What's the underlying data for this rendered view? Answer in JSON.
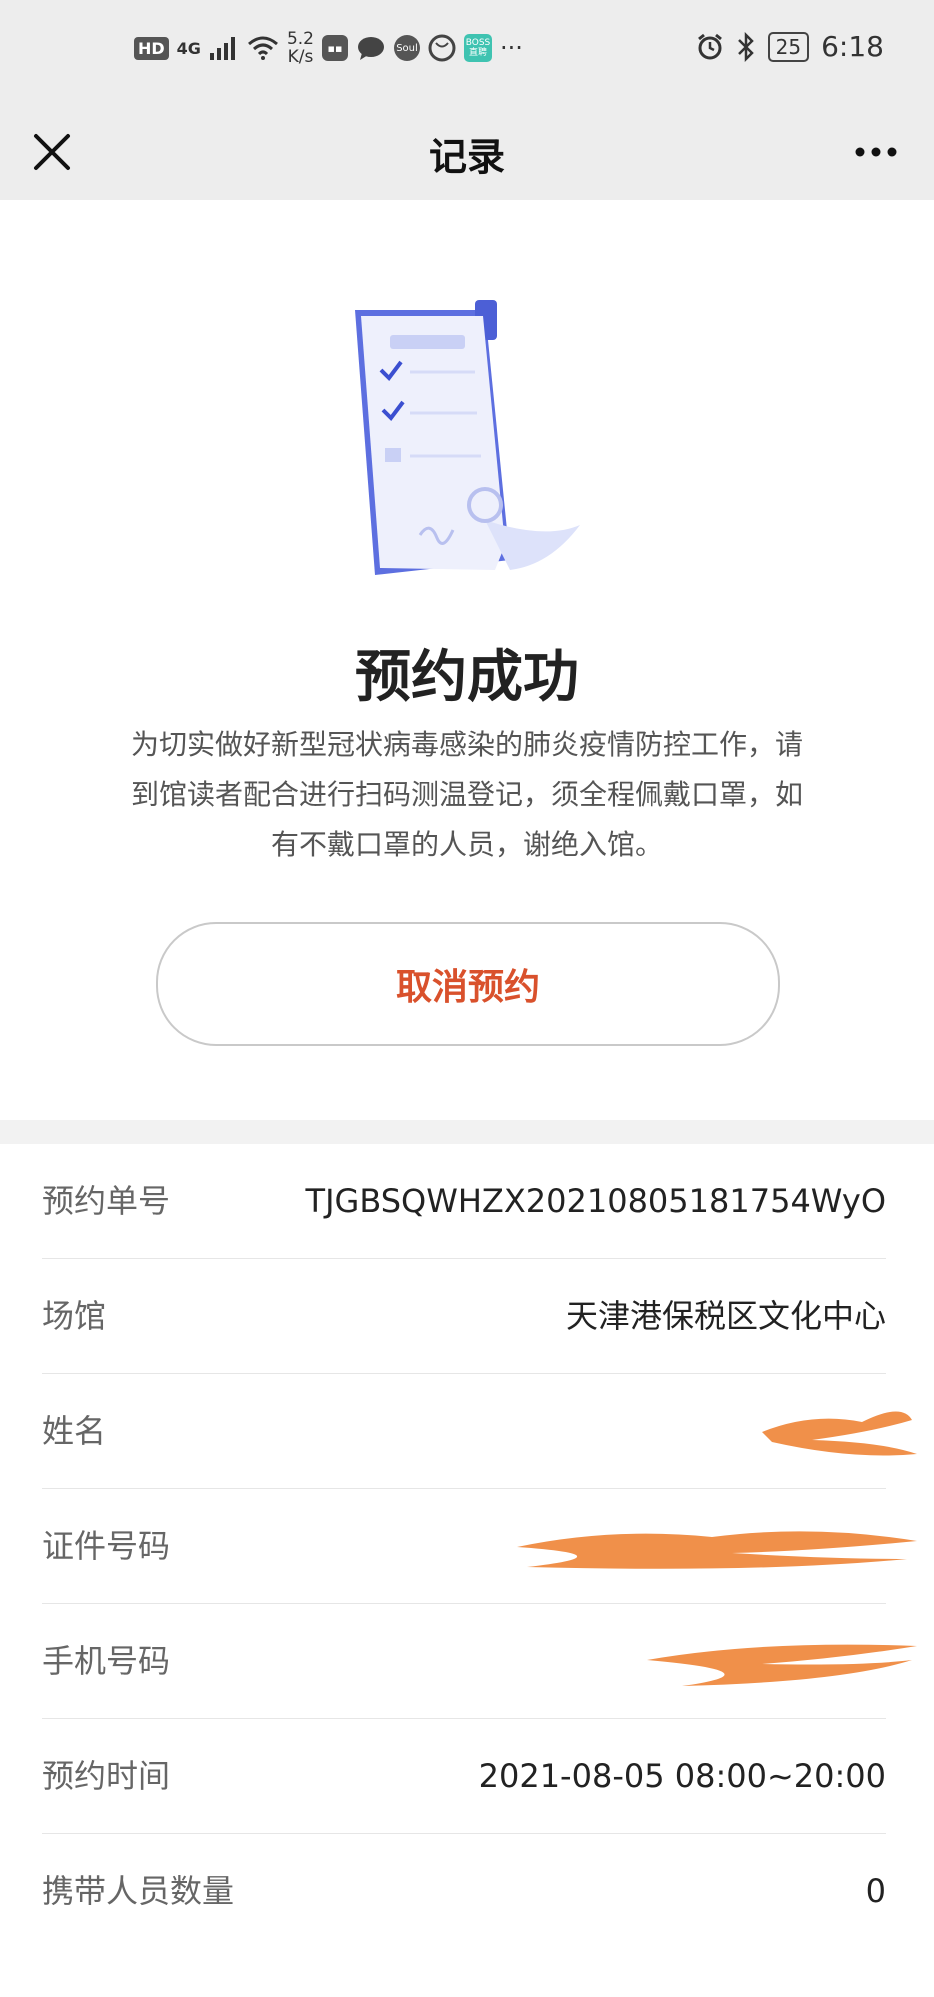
{
  "status_bar": {
    "hd": "HD",
    "network": "4G",
    "speed_value": "5.2",
    "speed_unit": "K/s",
    "soul": "Soul",
    "boss": "BOSS直聘",
    "more": "···",
    "battery": "25",
    "time": "6:18"
  },
  "nav": {
    "title": "记录"
  },
  "hero": {
    "title": "预约成功",
    "description": "为切实做好新型冠状病毒感染的肺炎疫情防控工作，请到馆读者配合进行扫码测温登记，须全程佩戴口罩，如有不戴口罩的人员，谢绝入馆。",
    "cancel_label": "取消预约"
  },
  "info": {
    "rows": [
      {
        "label": "预约单号",
        "value": "TJGBSQWHZX20210805181754WyO"
      },
      {
        "label": "场馆",
        "value": "天津港保税区文化中心"
      },
      {
        "label": "姓名",
        "value": "",
        "redacted": true
      },
      {
        "label": "证件号码",
        "value": "",
        "redacted": true
      },
      {
        "label": "手机号码",
        "value": "",
        "redacted": true
      },
      {
        "label": "预约时间",
        "value": "2021-08-05 08:00~20:00"
      },
      {
        "label": "携带人员数量",
        "value": "0"
      }
    ]
  },
  "colors": {
    "accent": "#d9512c",
    "redaction": "#f0904a",
    "nav_bg": "#ededed"
  }
}
